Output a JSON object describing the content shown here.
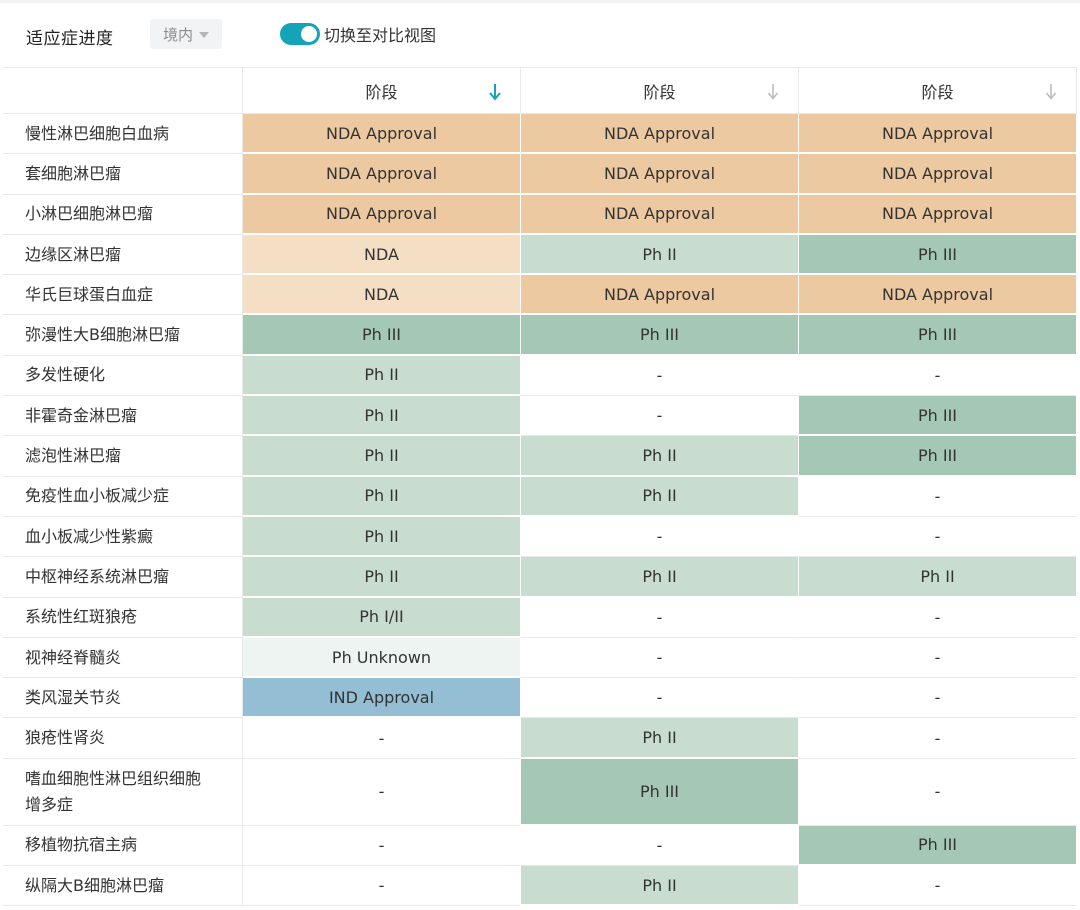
{
  "toolbar": {
    "title": "适应症进度",
    "region": "境内",
    "toggle_label": "切换至对比视图",
    "toggle_on": true,
    "accent_color": "#14a3b8"
  },
  "table": {
    "columns": [
      {
        "label": "阶段",
        "sort_active": true
      },
      {
        "label": "阶段",
        "sort_active": false
      },
      {
        "label": "阶段",
        "sort_active": false
      }
    ],
    "stage_colors": {
      "NDA Approval": "#ecc9a0",
      "NDA": "#f5dfc4",
      "Ph III": "#a5c7b5",
      "Ph II": "#c8ddd0",
      "Ph I/II": "#c8ddd0",
      "Ph Unknown": "#eef4f1",
      "IND Approval": "#93bed3",
      "-": "#ffffff"
    },
    "rows": [
      {
        "name": "慢性淋巴细胞白血病",
        "stages": [
          "NDA Approval",
          "NDA Approval",
          "NDA Approval"
        ]
      },
      {
        "name": "套细胞淋巴瘤",
        "stages": [
          "NDA Approval",
          "NDA Approval",
          "NDA Approval"
        ]
      },
      {
        "name": "小淋巴细胞淋巴瘤",
        "stages": [
          "NDA Approval",
          "NDA Approval",
          "NDA Approval"
        ]
      },
      {
        "name": "边缘区淋巴瘤",
        "stages": [
          "NDA",
          "Ph II",
          "Ph III"
        ]
      },
      {
        "name": "华氏巨球蛋白血症",
        "stages": [
          "NDA",
          "NDA Approval",
          "NDA Approval"
        ]
      },
      {
        "name": "弥漫性大B细胞淋巴瘤",
        "stages": [
          "Ph III",
          "Ph III",
          "Ph III"
        ]
      },
      {
        "name": "多发性硬化",
        "stages": [
          "Ph II",
          "-",
          "-"
        ]
      },
      {
        "name": "非霍奇金淋巴瘤",
        "stages": [
          "Ph II",
          "-",
          "Ph III"
        ]
      },
      {
        "name": "滤泡性淋巴瘤",
        "stages": [
          "Ph II",
          "Ph II",
          "Ph III"
        ]
      },
      {
        "name": "免疫性血小板减少症",
        "stages": [
          "Ph II",
          "Ph II",
          "-"
        ]
      },
      {
        "name": "血小板减少性紫癜",
        "stages": [
          "Ph II",
          "-",
          "-"
        ]
      },
      {
        "name": "中枢神经系统淋巴瘤",
        "stages": [
          "Ph II",
          "Ph II",
          "Ph II"
        ]
      },
      {
        "name": "系统性红斑狼疮",
        "stages": [
          "Ph I/II",
          "-",
          "-"
        ]
      },
      {
        "name": "视神经脊髓炎",
        "stages": [
          "Ph Unknown",
          "-",
          "-"
        ]
      },
      {
        "name": "类风湿关节炎",
        "stages": [
          "IND Approval",
          "-",
          "-"
        ]
      },
      {
        "name": "狼疮性肾炎",
        "stages": [
          "-",
          "Ph II",
          "-"
        ]
      },
      {
        "name": "嗜血细胞性淋巴组织细胞增多症",
        "stages": [
          "-",
          "Ph III",
          "-"
        ],
        "tall": true
      },
      {
        "name": "移植物抗宿主病",
        "stages": [
          "-",
          "-",
          "Ph III"
        ]
      },
      {
        "name": "纵隔大B细胞淋巴瘤",
        "stages": [
          "-",
          "Ph II",
          "-"
        ]
      }
    ]
  }
}
